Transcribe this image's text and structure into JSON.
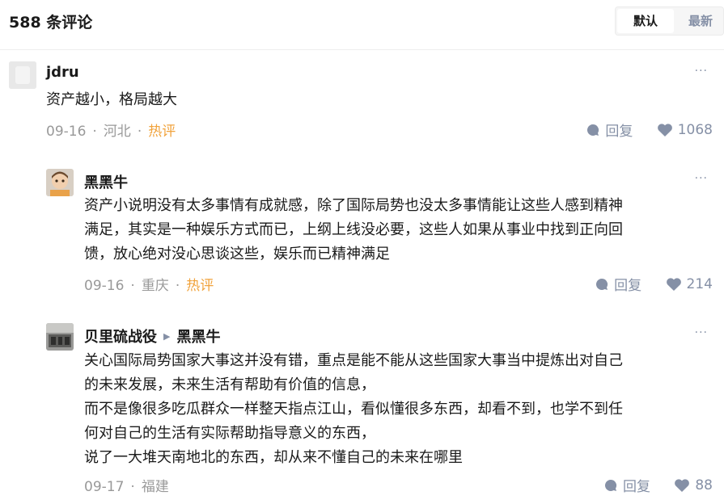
{
  "header": {
    "count_title": "588 条评论",
    "sort_default": "默认",
    "sort_latest": "最新"
  },
  "comments": [
    {
      "author": "jdru",
      "content": [
        "资产越小，格局越大"
      ],
      "date": "09-16",
      "location": "河北",
      "tag": "热评",
      "reply_label": "回复",
      "likes": "1068",
      "more": "···"
    },
    {
      "author": "黑黑牛",
      "content": [
        "资产小说明没有太多事情有成就感，除了国际局势也没太多事情能让这些人感到精神",
        "满足，其实是一种娱乐方式而已，上纲上线没必要，这些人如果从事业中找到正向回",
        "馈，放心绝对没心思谈这些，娱乐而已精神满足"
      ],
      "date": "09-16",
      "location": "重庆",
      "tag": "热评",
      "reply_label": "回复",
      "likes": "214",
      "more": "···"
    },
    {
      "author": "贝里硫战役",
      "reply_to": "黑黑牛",
      "content": [
        "关心国际局势国家大事这并没有错，重点是能不能从这些国家大事当中提炼出对自己",
        "的未来发展，未来生活有帮助有价值的信息，",
        "而不是像很多吃瓜群众一样整天指点江山，看似懂很多东西，却看不到，也学不到任",
        "何对自己的生活有实际帮助指导意义的东西，",
        "说了一大堆天南地北的东西，却从来不懂自己的未来在哪里"
      ],
      "date": "09-17",
      "location": "福建",
      "reply_label": "回复",
      "likes": "88",
      "more": "···"
    }
  ],
  "icons": {
    "reply": "comment-bubble-icon",
    "like": "heart-icon",
    "more": "more-dots-icon"
  },
  "colors": {
    "hot_tag": "#f1a33c",
    "meta": "#999999",
    "icon": "#8590a6"
  }
}
